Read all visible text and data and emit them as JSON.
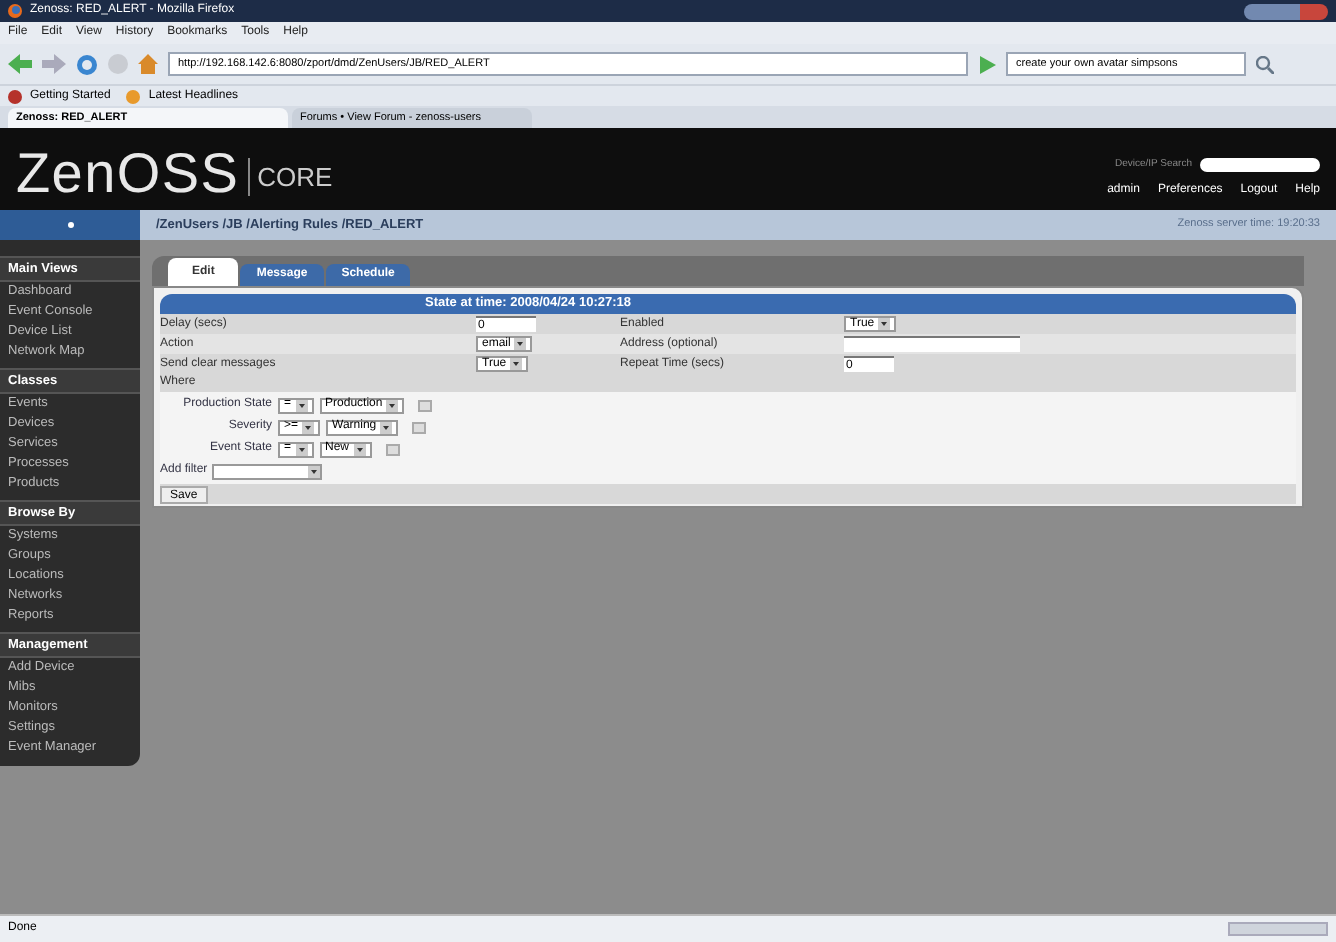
{
  "window": {
    "title": "Zenoss: RED_ALERT - Mozilla Firefox"
  },
  "menu": [
    "File",
    "Edit",
    "View",
    "History",
    "Bookmarks",
    "Tools",
    "Help"
  ],
  "address": {
    "value": "http://192.168.142.6:8080/zport/dmd/ZenUsers/JB/RED_ALERT"
  },
  "search": {
    "value": "create your own avatar simpsons"
  },
  "bookmarks": [
    "Getting Started",
    "Latest Headlines"
  ],
  "browser_tabs": [
    {
      "label": "Zenoss: RED_ALERT",
      "selected": true
    },
    {
      "label": "Forums • View Forum - zenoss-users",
      "selected": false
    }
  ],
  "header": {
    "logo": "ZenOSS",
    "product": "CORE",
    "search_label": "Device/IP Search",
    "links": [
      "admin",
      "Preferences",
      "Logout",
      "Help"
    ]
  },
  "breadcrumb": "/ZenUsers /JB /Alerting Rules /RED_ALERT",
  "server_time": "Zenoss server time: 19:20:33",
  "sidebar": [
    {
      "heading": "Main Views",
      "items": [
        "Dashboard",
        "Event Console",
        "Device List",
        "Network Map"
      ]
    },
    {
      "heading": "Classes",
      "items": [
        "Events",
        "Devices",
        "Services",
        "Processes",
        "Products"
      ]
    },
    {
      "heading": "Browse By",
      "items": [
        "Systems",
        "Groups",
        "Locations",
        "Networks",
        "Reports"
      ]
    },
    {
      "heading": "Management",
      "items": [
        "Add Device",
        "Mibs",
        "Monitors",
        "Settings",
        "Event Manager"
      ]
    }
  ],
  "tabs": [
    {
      "label": "Edit",
      "selected": true
    },
    {
      "label": "Message",
      "selected": false
    },
    {
      "label": "Schedule",
      "selected": false
    }
  ],
  "panel_title": "State at time: 2008/04/24 10:27:18",
  "fields": [
    {
      "label": "Delay (secs)",
      "kind": "text",
      "value": "0"
    },
    {
      "label": "Enabled",
      "kind": "select",
      "value": "True"
    },
    {
      "label": "Action",
      "kind": "select",
      "value": "email"
    },
    {
      "label": "Address (optional)",
      "kind": "text"
    },
    {
      "label": "Send clear messages",
      "kind": "select",
      "value": "True"
    },
    {
      "label": "Repeat Time (secs)",
      "kind": "text",
      "value": "0"
    }
  ],
  "where_label": "Where",
  "filters": [
    {
      "label": "Production State",
      "op": "=",
      "value": "Production"
    },
    {
      "label": "Severity",
      "op": ">=",
      "value": "Warning"
    },
    {
      "label": "Event State",
      "op": "=",
      "value": "New"
    }
  ],
  "add_filter_label": "Add filter",
  "save_button": "Save",
  "status_bar": "Done"
}
